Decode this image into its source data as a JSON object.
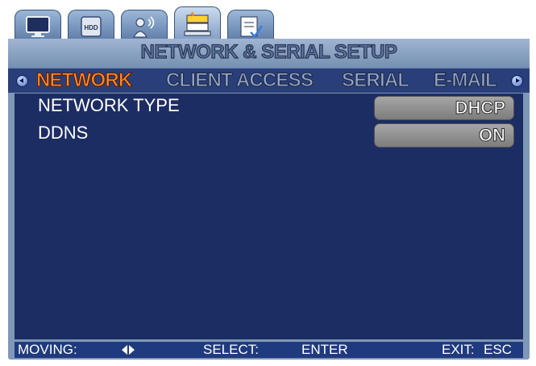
{
  "top_tabs": [
    {
      "icon": "monitor-icon",
      "label": ""
    },
    {
      "icon": "hdd-icon",
      "label": "HDD"
    },
    {
      "icon": "user-signal-icon",
      "label": ""
    },
    {
      "icon": "network-icon",
      "label": "",
      "active": true
    },
    {
      "icon": "system-check-icon",
      "label": ""
    }
  ],
  "window": {
    "title": "NETWORK & SERIAL SETUP"
  },
  "sub_tabs": [
    {
      "label": "NETWORK",
      "active": true
    },
    {
      "label": "CLIENT ACCESS"
    },
    {
      "label": "SERIAL"
    },
    {
      "label": "E-MAIL"
    }
  ],
  "settings": [
    {
      "label": "NETWORK TYPE",
      "value": "DHCP"
    },
    {
      "label": "DDNS",
      "value": "ON"
    }
  ],
  "status_bar": {
    "moving_label": "MOVING:",
    "select_label": "SELECT:",
    "select_value": "ENTER",
    "exit_label": "EXIT:",
    "exit_value": "ESC"
  },
  "colors": {
    "active_tab": "#ff8a2a",
    "content_bg": "#1c2d63",
    "frame": "#7f98b8"
  }
}
